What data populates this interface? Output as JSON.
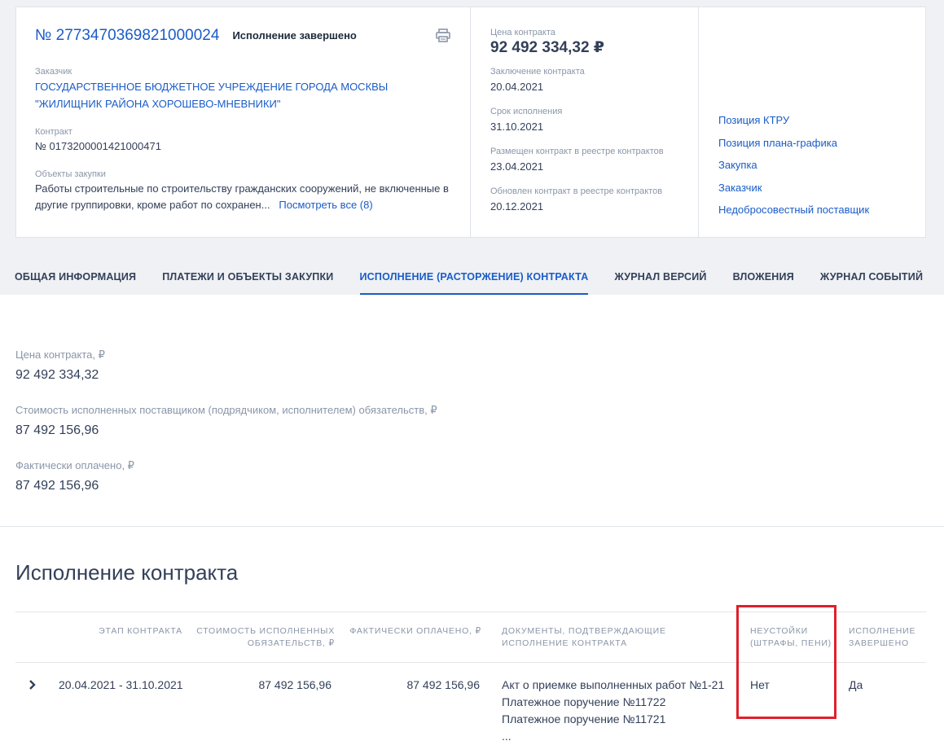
{
  "header": {
    "reg_number": "№ 2773470369821000024",
    "status": "Исполнение завершено",
    "customer_label": "Заказчик",
    "customer_name": "ГОСУДАРСТВЕННОЕ БЮДЖЕТНОЕ УЧРЕЖДЕНИЕ ГОРОДА МОСКВЫ \"ЖИЛИЩНИК РАЙОНА ХОРОШЕВО-МНЕВНИКИ\"",
    "contract_label": "Контракт",
    "contract_number": "№ 0173200001421000471",
    "objects_label": "Объекты закупки",
    "objects_text": "Работы строительные по строительству гражданских сооружений, не включенные в другие группировки, кроме работ по сохранен...",
    "objects_more": "Посмотреть все (8)",
    "price_label": "Цена контракта",
    "price_value": "92 492 334,32 ₽",
    "concluded_label": "Заключение контракта",
    "concluded_value": "20.04.2021",
    "term_label": "Срок исполнения",
    "term_value": "31.10.2021",
    "placed_label": "Размещен контракт в реестре контрактов",
    "placed_value": "23.04.2021",
    "updated_label": "Обновлен контракт в реестре контрактов",
    "updated_value": "20.12.2021",
    "links": [
      "Позиция КТРУ",
      "Позиция плана-графика",
      "Закупка",
      "Заказчик",
      "Недобросовестный поставщик"
    ]
  },
  "tabs": [
    {
      "label": "ОБЩАЯ ИНФОРМАЦИЯ",
      "active": false
    },
    {
      "label": "ПЛАТЕЖИ И ОБЪЕКТЫ ЗАКУПКИ",
      "active": false
    },
    {
      "label": "ИСПОЛНЕНИЕ (РАСТОРЖЕНИЕ) КОНТРАКТА",
      "active": true
    },
    {
      "label": "ЖУРНАЛ ВЕРСИЙ",
      "active": false
    },
    {
      "label": "ВЛОЖЕНИЯ",
      "active": false
    },
    {
      "label": "ЖУРНАЛ СОБЫТИЙ",
      "active": false
    }
  ],
  "summary": [
    {
      "label": "Цена контракта, ₽",
      "value": "92 492 334,32"
    },
    {
      "label": "Стоимость исполненных поставщиком (подрядчиком, исполнителем) обязательств, ₽",
      "value": "87 492 156,96"
    },
    {
      "label": "Фактически оплачено, ₽",
      "value": "87 492 156,96"
    }
  ],
  "execution": {
    "title": "Исполнение контракта",
    "columns": {
      "stage": "ЭТАП КОНТРАКТА",
      "cost": "СТОИМОСТЬ ИСПОЛНЕННЫХ ОБЯЗАТЕЛЬСТВ, ₽",
      "paid": "ФАКТИЧЕСКИ ОПЛАЧЕНО, ₽",
      "docs": "ДОКУМЕНТЫ, ПОДТВЕРЖДАЮЩИЕ ИСПОЛНЕНИЕ КОНТРАКТА",
      "penalties": "НЕУСТОЙКИ (ШТРАФЫ, ПЕНИ)",
      "completed": "ИСПОЛНЕНИЕ ЗАВЕРШЕНО"
    },
    "row": {
      "stage": "20.04.2021 - 31.10.2021",
      "cost": "87 492 156,96",
      "paid": "87 492 156,96",
      "docs": [
        "Акт о приемке выполненных работ №1-21",
        "Платежное поручение №11722",
        "Платежное поручение №11721",
        "..."
      ],
      "penalties": "Нет",
      "completed": "Да"
    }
  },
  "colors": {
    "accent": "#1a5cc8",
    "highlight": "#e0202c"
  }
}
